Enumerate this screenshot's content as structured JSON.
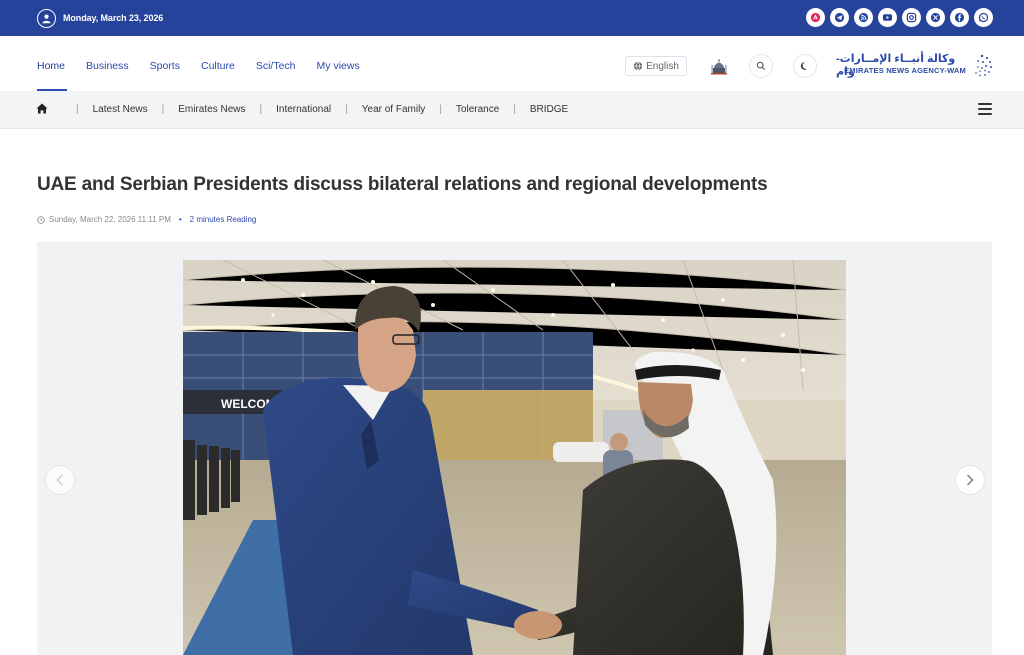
{
  "topbar": {
    "date": "Monday, March 23, 2026",
    "socials": [
      "app-store-icon",
      "telegram-icon",
      "rss-icon",
      "youtube-icon",
      "instagram-icon",
      "x-icon",
      "facebook-icon",
      "whatsapp-icon"
    ]
  },
  "nav": {
    "items": [
      "Home",
      "Business",
      "Sports",
      "Culture",
      "Sci/Tech",
      "My views"
    ],
    "active": "Home",
    "language": "English"
  },
  "logo": {
    "arabic": "وكالة أنبــاء الإمــارات- وام",
    "english": "EMIRATES NEWS AGENCY-WAM"
  },
  "subnav": {
    "items": [
      "Latest News",
      "Emirates News",
      "International",
      "Year of Family",
      "Tolerance",
      "BRIDGE"
    ]
  },
  "article": {
    "title": "UAE and Serbian Presidents discuss bilateral relations and regional developments",
    "datetime": "Sunday, March 22, 2026 11:11 PM",
    "reading": "2 minutes Reading"
  },
  "photo": {
    "sign_text": "WELCOME TO AB"
  },
  "colors": {
    "brand": "#25439a",
    "link": "#2a4bb0"
  }
}
